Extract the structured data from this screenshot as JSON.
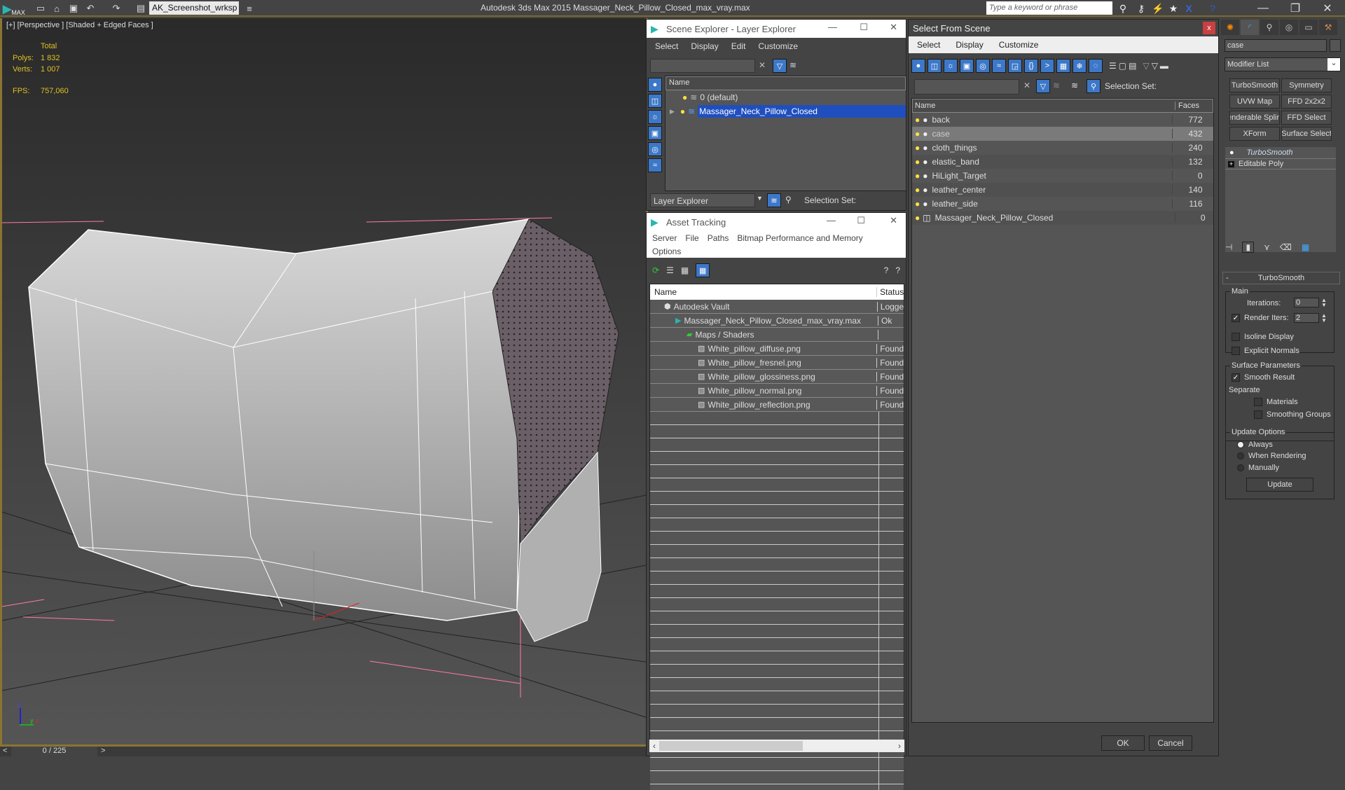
{
  "titlebar": {
    "app_logo": "MAX",
    "workspace": "AK_Screenshot_wrksp",
    "title": "Autodesk 3ds Max  2015    Massager_Neck_Pillow_Closed_max_vray.max",
    "search_placeholder": "Type a keyword or phrase"
  },
  "viewport": {
    "label": "[+] [Perspective ] [Shaded + Edged Faces ]",
    "stats": {
      "total_label": "Total",
      "polys_label": "Polys:",
      "polys": "1 832",
      "verts_label": "Verts:",
      "verts": "1 007",
      "fps_label": "FPS:",
      "fps": "757,060"
    },
    "axis": {
      "z": "z",
      "y": "y",
      "x": "x"
    },
    "timeline": {
      "prev": "<",
      "frame": "0 / 225",
      "next": ">"
    }
  },
  "scene_explorer": {
    "title": "Scene Explorer - Layer Explorer",
    "menu": [
      "Select",
      "Display",
      "Edit",
      "Customize"
    ],
    "column_name": "Name",
    "layers": [
      {
        "name": "0 (default)",
        "selected": false
      },
      {
        "name": "Massager_Neck_Pillow_Closed",
        "selected": true
      }
    ],
    "explorer_dropdown": "Layer Explorer",
    "selection_set_label": "Selection Set:"
  },
  "asset_tracking": {
    "title": "Asset Tracking",
    "menu": [
      "Server",
      "File",
      "Paths",
      "Bitmap Performance and Memory",
      "Options"
    ],
    "columns": [
      "Name",
      "Status"
    ],
    "rows": [
      {
        "name": "Autodesk Vault",
        "status": "Logge",
        "indent": 0,
        "icon": "vault-icon"
      },
      {
        "name": "Massager_Neck_Pillow_Closed_max_vray.max",
        "status": "Ok",
        "indent": 1,
        "icon": "max-file-icon"
      },
      {
        "name": "Maps / Shaders",
        "status": "",
        "indent": 2,
        "icon": "maps-icon"
      },
      {
        "name": "White_pillow_diffuse.png",
        "status": "Found",
        "indent": 3,
        "icon": "image-file-icon"
      },
      {
        "name": "White_pillow_fresnel.png",
        "status": "Found",
        "indent": 3,
        "icon": "image-file-icon"
      },
      {
        "name": "White_pillow_glossiness.png",
        "status": "Found",
        "indent": 3,
        "icon": "image-file-icon"
      },
      {
        "name": "White_pillow_normal.png",
        "status": "Found",
        "indent": 3,
        "icon": "image-file-icon"
      },
      {
        "name": "White_pillow_reflection.png",
        "status": "Found",
        "indent": 3,
        "icon": "image-file-icon"
      }
    ]
  },
  "select_from_scene": {
    "title": "Select From Scene",
    "menu": [
      "Select",
      "Display",
      "Customize"
    ],
    "selection_set_label": "Selection Set:",
    "columns": [
      "Name",
      "Faces"
    ],
    "objects": [
      {
        "name": "back",
        "faces": "772",
        "selected": false
      },
      {
        "name": "case",
        "faces": "432",
        "selected": true
      },
      {
        "name": "cloth_things",
        "faces": "240",
        "selected": false
      },
      {
        "name": "elastic_band",
        "faces": "132",
        "selected": false
      },
      {
        "name": "HiLight_Target",
        "faces": "0",
        "selected": false
      },
      {
        "name": "leather_center",
        "faces": "140",
        "selected": false
      },
      {
        "name": "leather_side",
        "faces": "116",
        "selected": false
      },
      {
        "name": "Massager_Neck_Pillow_Closed",
        "faces": "0",
        "selected": false
      }
    ],
    "ok": "OK",
    "cancel": "Cancel"
  },
  "command_panel": {
    "object_name": "case",
    "modifier_list": "Modifier List",
    "modifier_buttons": [
      "TurboSmooth",
      "Symmetry",
      "UVW Map",
      "FFD 2x2x2",
      "enderable Splir",
      "FFD Select",
      "XForm",
      "Surface Select"
    ],
    "stack": [
      "TurboSmooth",
      "Editable Poly"
    ],
    "rollout_title": "TurboSmooth",
    "main_label": "Main",
    "iterations_label": "Iterations:",
    "iterations": "0",
    "render_iters_label": "Render Iters:",
    "render_iters": "2",
    "render_iters_checked": true,
    "isoline_label": "Isoline Display",
    "explicit_normals_label": "Explicit Normals",
    "surface_params_label": "Surface Parameters",
    "smooth_result_label": "Smooth Result",
    "separate_label": "Separate",
    "materials_label": "Materials",
    "smoothing_groups_label": "Smoothing Groups",
    "update_options_label": "Update Options",
    "update_options": [
      "Always",
      "When Rendering",
      "Manually"
    ],
    "update_selected": "Always",
    "update_button": "Update"
  }
}
